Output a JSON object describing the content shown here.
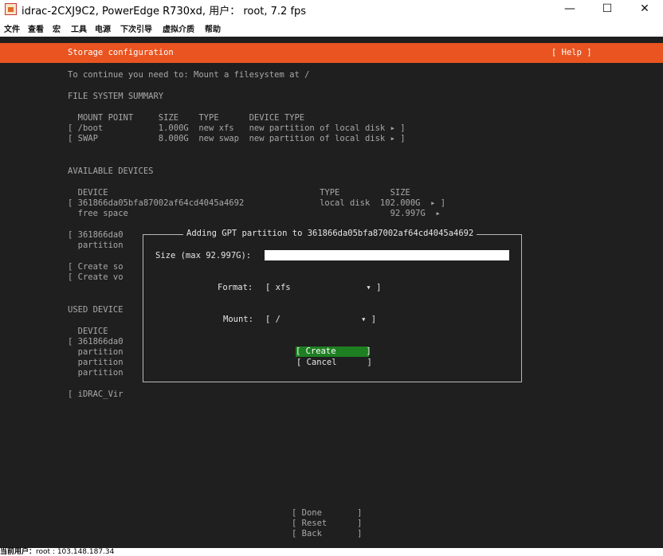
{
  "window": {
    "title": "idrac-2CXJ9C2, PowerEdge R730xd, 用户： root, 7.2 fps",
    "minimize_glyph": "—",
    "maximize_glyph": "☐",
    "close_glyph": "✕"
  },
  "menu": [
    "文件",
    "查看",
    "宏",
    "工具",
    "电源",
    "下次引导",
    "虚拟介质",
    "帮助"
  ],
  "terminal": {
    "header_title": "Storage configuration",
    "help": "[ Help ]",
    "accent_color": "#e95420",
    "instruction": "To continue you need to: Mount a filesystem at /",
    "fs_summary_title": "FILE SYSTEM SUMMARY",
    "fs_header": "  MOUNT POINT     SIZE    TYPE      DEVICE TYPE",
    "fs_rows": [
      "[ /boot           1.000G  new xfs   new partition of local disk ▸ ]",
      "[ SWAP            8.000G  new swap  new partition of local disk ▸ ]"
    ],
    "available_title": "AVAILABLE DEVICES",
    "avail_header": "  DEVICE                                          TYPE          SIZE",
    "avail_rows": [
      "[ 361866da05bfa87002af64cd4045a4692               local disk  102.000G  ▸ ]",
      "  free space                                                    92.997G  ▸"
    ],
    "left_partial": [
      "[ 361866da0",
      "  partition",
      "",
      "[ Create so",
      "[ Create vo"
    ],
    "used_title": "USED DEVICE",
    "used_rows": [
      "  DEVICE",
      "[ 361866da0",
      "  partition",
      "  partition",
      "  partition"
    ],
    "idrac_partial": "[ iDRAC_Vir",
    "bottom_buttons": [
      "[ Done       ]",
      "[ Reset      ]",
      "[ Back       ]"
    ]
  },
  "dialog": {
    "title": "Adding GPT partition to 361866da05bfa87002af64cd4045a4692",
    "size_label": "Size (max 92.997G):",
    "size_value": "",
    "format_label": "Format:",
    "format_value": "[ xfs               ▾ ]",
    "mount_label": "Mount:",
    "mount_value": "[ /                ▾ ]",
    "create_button": "[ Create      ]",
    "cancel_button": "[ Cancel      ]",
    "create_color": "#1e7f22"
  },
  "statusbar": {
    "label": "当前用户：",
    "value": "root : 103.148.187.34"
  }
}
